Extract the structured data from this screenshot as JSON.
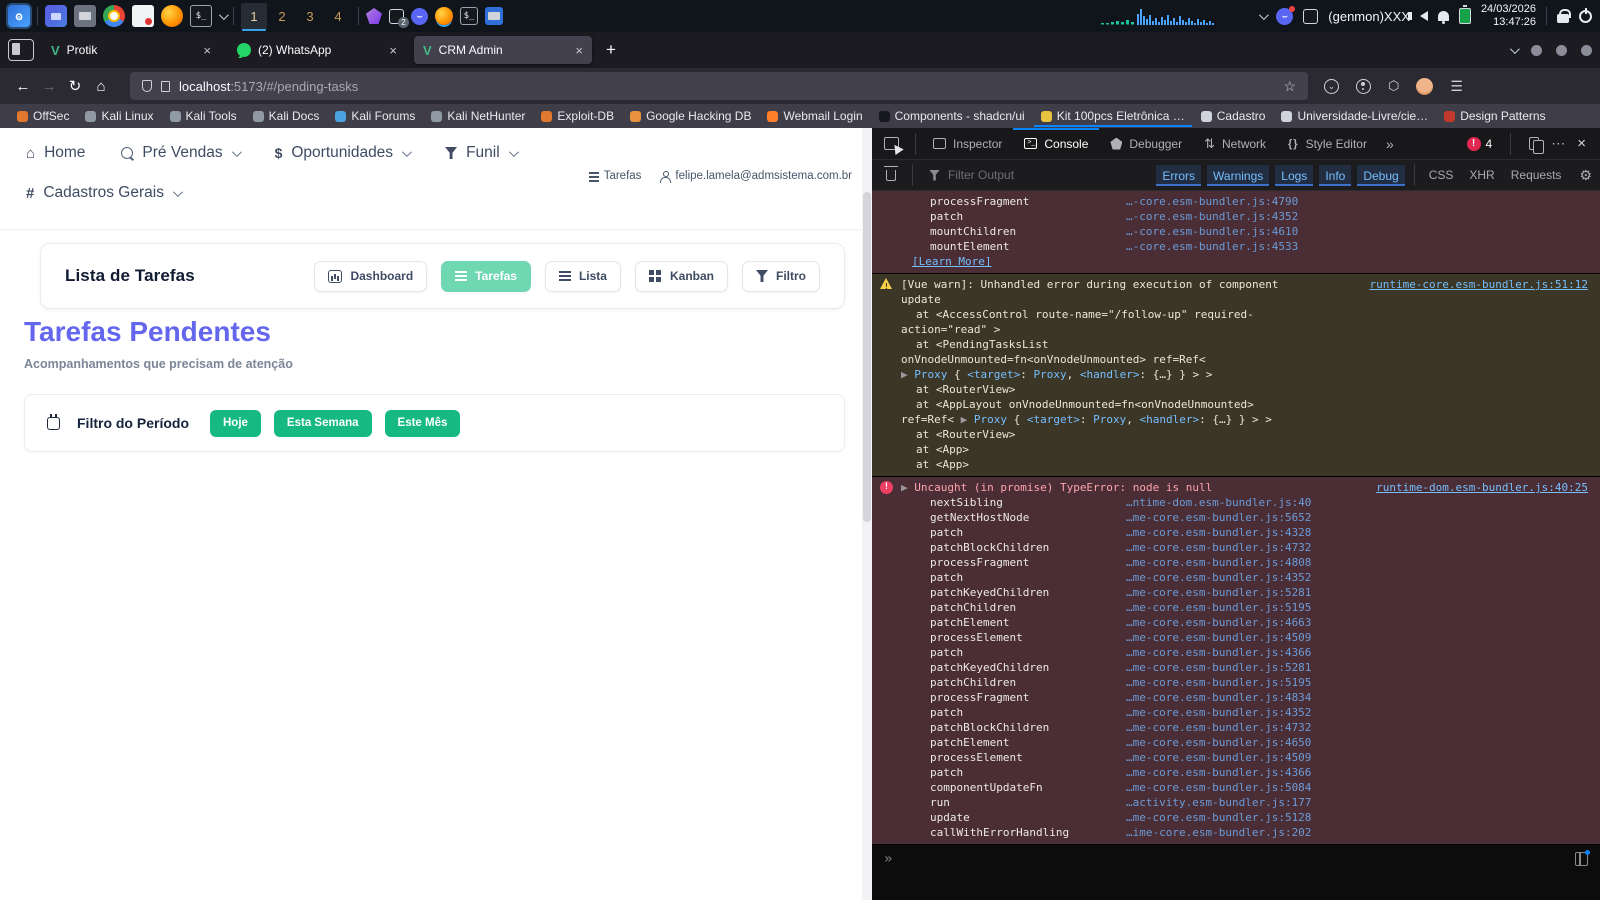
{
  "system_bar": {
    "workspaces": {
      "items": [
        "1",
        "2",
        "3",
        "4"
      ],
      "active_index": 0
    },
    "tray_badge": "2",
    "status": {
      "app_label": "(genmon)XXX",
      "date": "24/03/2026",
      "time": "13:47:26"
    }
  },
  "browser": {
    "tabs": [
      {
        "title": "Protik",
        "favicon": "vue",
        "active": false
      },
      {
        "title": "(2) WhatsApp",
        "favicon": "whatsapp",
        "active": false
      },
      {
        "title": "CRM Admin",
        "favicon": "vue",
        "active": true
      }
    ],
    "new_tab_label": "+",
    "url_host": "localhost",
    "url_rest": ":5173/#/pending-tasks",
    "bookmarks": [
      {
        "label": "OffSec",
        "color": "#e2772e",
        "underlined": false
      },
      {
        "label": "Kali Linux",
        "color": "#8f9aa5",
        "underlined": false
      },
      {
        "label": "Kali Tools",
        "color": "#8f9aa5",
        "underlined": false
      },
      {
        "label": "Kali Docs",
        "color": "#8f9aa5",
        "underlined": false
      },
      {
        "label": "Kali Forums",
        "color": "#4aa3e0",
        "underlined": false
      },
      {
        "label": "Kali NetHunter",
        "color": "#8f9aa5",
        "underlined": false
      },
      {
        "label": "Exploit-DB",
        "color": "#e2772e",
        "underlined": false
      },
      {
        "label": "Google Hacking DB",
        "color": "#e8913f",
        "underlined": false
      },
      {
        "label": "Webmail Login",
        "color": "#ff7f2a",
        "underlined": false
      },
      {
        "label": "Components - shadcn/ui",
        "color": "#16181d",
        "underlined": false
      },
      {
        "label": "Kit 100pcs Eletrônica …",
        "color": "#e8c33f",
        "underlined": true
      },
      {
        "label": "Cadastro",
        "color": "#cfd5db",
        "underlined": false
      },
      {
        "label": "Universidade-Livre/cie…",
        "color": "#cfd5db",
        "underlined": false
      },
      {
        "label": "Design Patterns",
        "color": "#c0392b",
        "underlined": false
      }
    ]
  },
  "app": {
    "nav": [
      {
        "label": "Home",
        "icon": "home",
        "caret": false
      },
      {
        "label": "Pré Vendas",
        "icon": "bubble",
        "caret": true
      },
      {
        "label": "Oportunidades",
        "icon": "dollar",
        "caret": true
      },
      {
        "label": "Funil",
        "icon": "funnel",
        "caret": true
      }
    ],
    "nav_secondary": {
      "label": "Cadastros Gerais",
      "icon": "hash",
      "caret": true
    },
    "user_bar": {
      "tasks_label": "Tarefas",
      "email": "felipe.lamela@admsistema.com.br"
    },
    "task_card": {
      "title": "Lista de Tarefas",
      "view_buttons": [
        {
          "label": "Dashboard",
          "icon": "chart",
          "active": false
        },
        {
          "label": "Tarefas",
          "icon": "list",
          "active": true
        },
        {
          "label": "Lista",
          "icon": "list",
          "active": false
        },
        {
          "label": "Kanban",
          "icon": "grid",
          "active": false
        },
        {
          "label": "Filtro",
          "icon": "funnel",
          "active": false
        }
      ]
    },
    "page_title": "Tarefas Pendentes",
    "page_subtitle": "Acompanhamentos que precisam de atenção",
    "period_filter": {
      "title": "Filtro do Período",
      "options": [
        "Hoje",
        "Esta Semana",
        "Este Mês"
      ]
    },
    "colors": {
      "accent_green": "#16b981",
      "active_view_green": "#6fd7b2",
      "title_purple": "#6467ee"
    }
  },
  "devtools": {
    "tabs": [
      {
        "label": "Inspector",
        "icon": "inspector",
        "active": false
      },
      {
        "label": "Console",
        "icon": "console",
        "active": true
      },
      {
        "label": "Debugger",
        "icon": "debugger",
        "active": false
      },
      {
        "label": "Network",
        "icon": "network",
        "active": false
      },
      {
        "label": "Style Editor",
        "icon": "style",
        "active": false
      }
    ],
    "more_tabs_glyph": "»",
    "error_count": "4",
    "filter_placeholder": "Filter Output",
    "level_filters_on": [
      "Errors",
      "Warnings",
      "Logs",
      "Info",
      "Debug"
    ],
    "type_filters_off": [
      "CSS",
      "XHR",
      "Requests"
    ],
    "console_prompt": "»",
    "messages": [
      {
        "type": "error",
        "rows": [
          {
            "fn": "processFragment",
            "loc": "…-core.esm-bundler.js:4790"
          },
          {
            "fn": "patch",
            "loc": "…-core.esm-bundler.js:4352"
          },
          {
            "fn": "mountChildren",
            "loc": "…-core.esm-bundler.js:4610"
          },
          {
            "fn": "mountElement",
            "loc": "…-core.esm-bundler.js:4533"
          },
          {
            "link": "[Learn More]"
          }
        ]
      },
      {
        "type": "warn",
        "header": {
          "segs": [
            [
              "[Vue warn]: Unhandled error during execution of component",
              "w"
            ]
          ],
          "link": "runtime-core.esm-bundler.js:51:12"
        },
        "rows": [
          {
            "ind": 29,
            "segs": [
              [
                "update",
                "w"
              ]
            ]
          },
          {
            "ind": 44,
            "segs": [
              [
                "at <AccessControl route-name=\"/follow-up\" required-",
                "w"
              ]
            ]
          },
          {
            "ind": 29,
            "segs": [
              [
                "action=\"read\" >",
                "w"
              ]
            ]
          },
          {
            "ind": 44,
            "segs": [
              [
                "at <PendingTasksList",
                "w"
              ]
            ]
          },
          {
            "ind": 29,
            "segs": [
              [
                "onVnodeUnmounted=fn<onVnodeUnmounted> ref=Ref<",
                "w"
              ]
            ]
          },
          {
            "ind": 29,
            "segs": [
              [
                "▶ ",
                "t"
              ],
              [
                "Proxy",
                "b"
              ],
              [
                " { ",
                "w"
              ],
              [
                "<target>",
                "b"
              ],
              [
                ": ",
                "w"
              ],
              [
                "Proxy",
                "b"
              ],
              [
                ", ",
                "w"
              ],
              [
                "<handler>",
                "b"
              ],
              [
                ": {…} } > >",
                "w"
              ]
            ]
          },
          {
            "ind": 44,
            "segs": [
              [
                "at <RouterView>",
                "w"
              ]
            ]
          },
          {
            "ind": 44,
            "segs": [
              [
                "at <AppLayout onVnodeUnmounted=fn<onVnodeUnmounted>",
                "w"
              ]
            ]
          },
          {
            "ind": 29,
            "segs": [
              [
                "ref=Ref< ",
                "w"
              ],
              [
                "▶ ",
                "t"
              ],
              [
                "Proxy",
                "b"
              ],
              [
                " { ",
                "w"
              ],
              [
                "<target>",
                "b"
              ],
              [
                ": ",
                "w"
              ],
              [
                "Proxy",
                "b"
              ],
              [
                ", ",
                "w"
              ],
              [
                "<handler>",
                "b"
              ],
              [
                ": {…} } > >",
                "w"
              ]
            ]
          },
          {
            "ind": 44,
            "segs": [
              [
                "at <RouterView>",
                "w"
              ]
            ]
          },
          {
            "ind": 44,
            "segs": [
              [
                "at <App>",
                "w"
              ]
            ]
          },
          {
            "ind": 44,
            "segs": [
              [
                "at <App>",
                "w"
              ]
            ]
          }
        ]
      },
      {
        "type": "error",
        "header": {
          "segs": [
            [
              "▶ ",
              "t"
            ],
            [
              "Uncaught (in promise) TypeError: node is null",
              "e"
            ]
          ],
          "link": "runtime-dom.esm-bundler.js:40:25"
        },
        "rows": [
          {
            "fn": "nextSibling",
            "loc": "…ntime-dom.esm-bundler.js:40"
          },
          {
            "fn": "getNextHostNode",
            "loc": "…me-core.esm-bundler.js:5652"
          },
          {
            "fn": "patch",
            "loc": "…me-core.esm-bundler.js:4328"
          },
          {
            "fn": "patchBlockChildren",
            "loc": "…me-core.esm-bundler.js:4732"
          },
          {
            "fn": "processFragment",
            "loc": "…me-core.esm-bundler.js:4808"
          },
          {
            "fn": "patch",
            "loc": "…me-core.esm-bundler.js:4352"
          },
          {
            "fn": "patchKeyedChildren",
            "loc": "…me-core.esm-bundler.js:5281"
          },
          {
            "fn": "patchChildren",
            "loc": "…me-core.esm-bundler.js:5195"
          },
          {
            "fn": "patchElement",
            "loc": "…me-core.esm-bundler.js:4663"
          },
          {
            "fn": "processElement",
            "loc": "…me-core.esm-bundler.js:4509"
          },
          {
            "fn": "patch",
            "loc": "…me-core.esm-bundler.js:4366"
          },
          {
            "fn": "patchKeyedChildren",
            "loc": "…me-core.esm-bundler.js:5281"
          },
          {
            "fn": "patchChildren",
            "loc": "…me-core.esm-bundler.js:5195"
          },
          {
            "fn": "processFragment",
            "loc": "…me-core.esm-bundler.js:4834"
          },
          {
            "fn": "patch",
            "loc": "…me-core.esm-bundler.js:4352"
          },
          {
            "fn": "patchBlockChildren",
            "loc": "…me-core.esm-bundler.js:4732"
          },
          {
            "fn": "patchElement",
            "loc": "…me-core.esm-bundler.js:4650"
          },
          {
            "fn": "processElement",
            "loc": "…me-core.esm-bundler.js:4509"
          },
          {
            "fn": "patch",
            "loc": "…me-core.esm-bundler.js:4366"
          },
          {
            "fn": "componentUpdateFn",
            "loc": "…me-core.esm-bundler.js:5084"
          },
          {
            "fn": "run",
            "loc": "…activity.esm-bundler.js:177"
          },
          {
            "fn": "update",
            "loc": "…me-core.esm-bundler.js:5128"
          },
          {
            "fn": "callWithErrorHandling",
            "loc": "…ime-core.esm-bundler.js:202"
          }
        ]
      }
    ]
  }
}
